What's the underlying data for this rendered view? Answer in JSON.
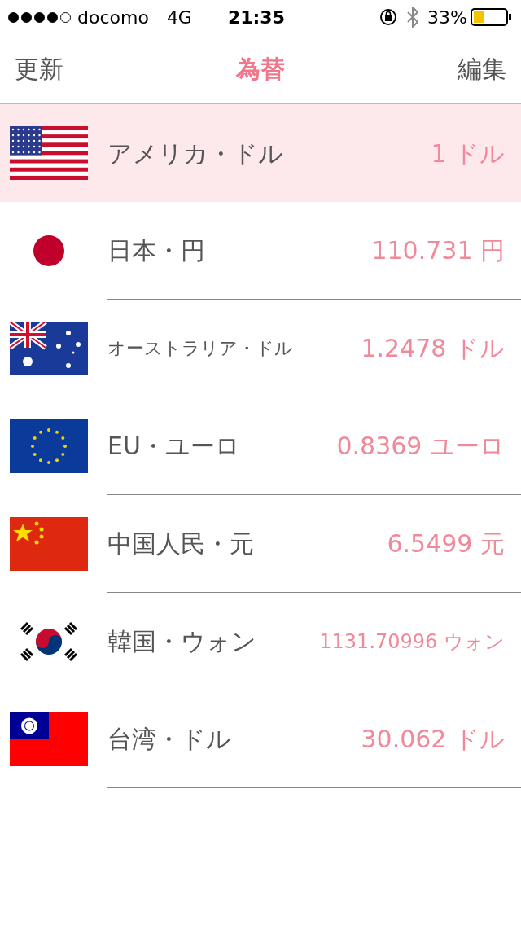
{
  "status_bar": {
    "carrier": "docomo",
    "network": "4G",
    "time": "21:35",
    "battery": "33%"
  },
  "nav": {
    "left": "更新",
    "title": "為替",
    "right": "編集"
  },
  "rows": [
    {
      "name": "アメリカ・ドル",
      "value": "1 ドル",
      "selected": true
    },
    {
      "name": "日本・円",
      "value": "110.731 円",
      "selected": false
    },
    {
      "name": "オーストラリア・ドル",
      "value": "1.2478 ドル",
      "selected": false
    },
    {
      "name": "EU・ユーロ",
      "value": "0.8369 ユーロ",
      "selected": false
    },
    {
      "name": "中国人民・元",
      "value": "6.5499 元",
      "selected": false
    },
    {
      "name": "韓国・ウォン",
      "value": "1131.70996 ウォン",
      "selected": false
    },
    {
      "name": "台湾・ドル",
      "value": "30.062 ドル",
      "selected": false
    }
  ]
}
